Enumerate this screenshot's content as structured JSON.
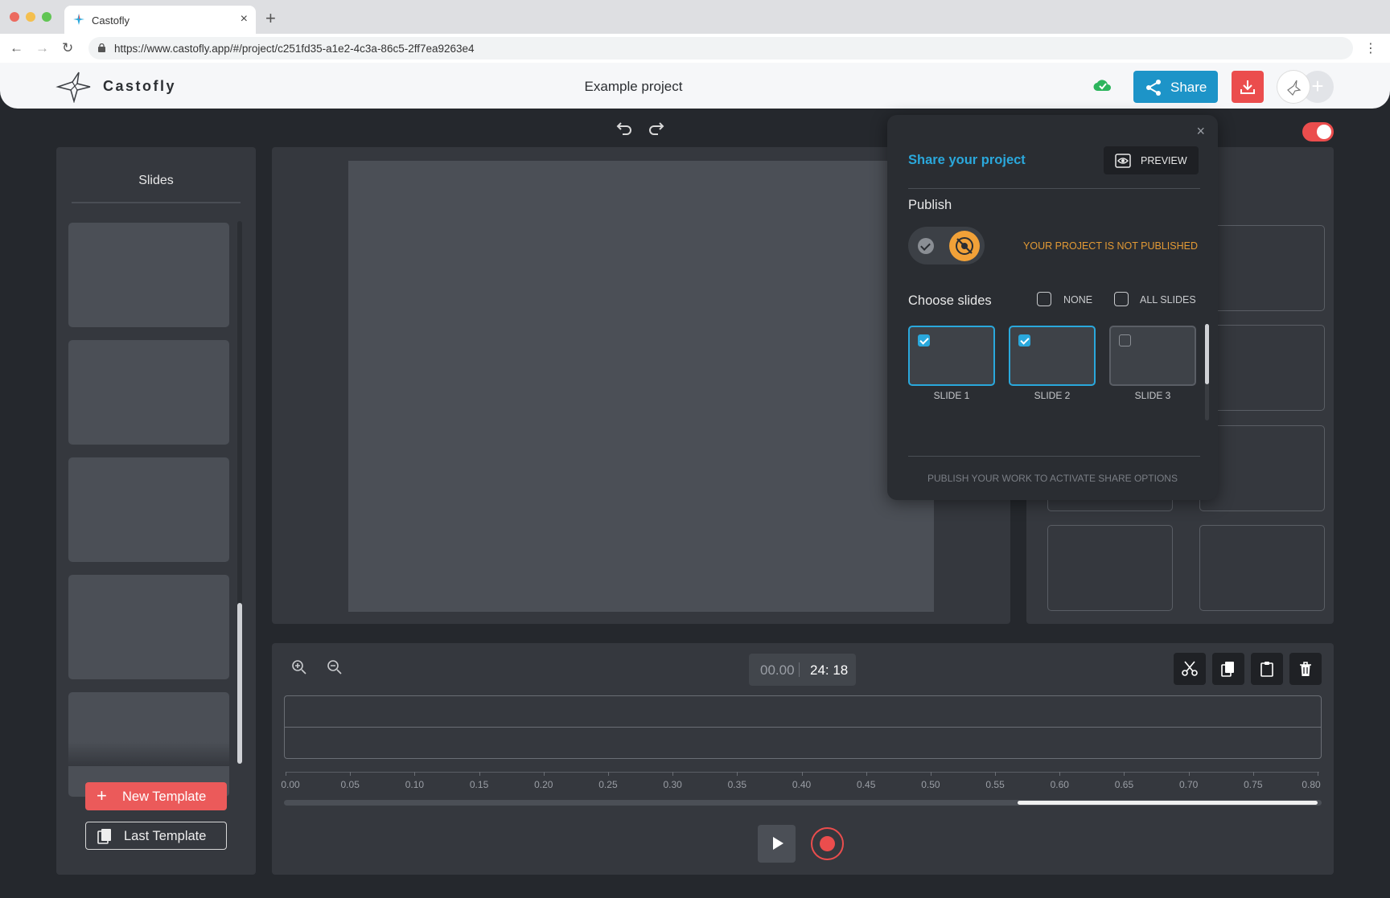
{
  "browser": {
    "tab_title": "Castofly",
    "url": "https://www.castofly.app/#/project/c251fd35-a1e2-4c3a-86c5-2ff7ea9263e4",
    "traffic_colors": [
      "#ec6a5f",
      "#f4bf4f",
      "#61c554"
    ]
  },
  "header": {
    "brand": "Castofly",
    "project_title": "Example project",
    "share_label": "Share",
    "accent": "#1d94c8",
    "download_color": "#eb4d4d"
  },
  "slides_panel": {
    "title": "Slides",
    "thumb_count": 5,
    "new_template_label": "New Template",
    "last_template_label": "Last Template"
  },
  "timeline": {
    "current_time": "00.00",
    "total_time": "24: 18",
    "ruler_labels": [
      "0.00",
      "0.05",
      "0.10",
      "0.15",
      "0.20",
      "0.25",
      "0.30",
      "0.35",
      "0.40",
      "0.45",
      "0.50",
      "0.55",
      "0.60",
      "0.65",
      "0.70",
      "0.75",
      "0.80"
    ],
    "tools": [
      "scissors-icon",
      "copy-icon",
      "paste-icon",
      "trash-icon"
    ]
  },
  "share_popup": {
    "title": "Share your project",
    "preview_label": "PREVIEW",
    "publish_heading": "Publish",
    "publish_status": "YOUR PROJECT IS NOT PUBLISHED",
    "choose_slides_heading": "Choose slides",
    "none_label": "NONE",
    "all_slides_label": "ALL SLIDES",
    "slides": [
      {
        "label": "SLIDE 1",
        "selected": true
      },
      {
        "label": "SLIDE 2",
        "selected": true
      },
      {
        "label": "SLIDE 3",
        "selected": false
      },
      {
        "label": "",
        "selected": true
      },
      {
        "label": "",
        "selected": false
      },
      {
        "label": "",
        "selected": true
      }
    ],
    "footer": "PUBLISH YOUR WORK TO ACTIVATE SHARE OPTIONS",
    "title_color": "#2aa8dc",
    "status_color": "#e39a35"
  }
}
